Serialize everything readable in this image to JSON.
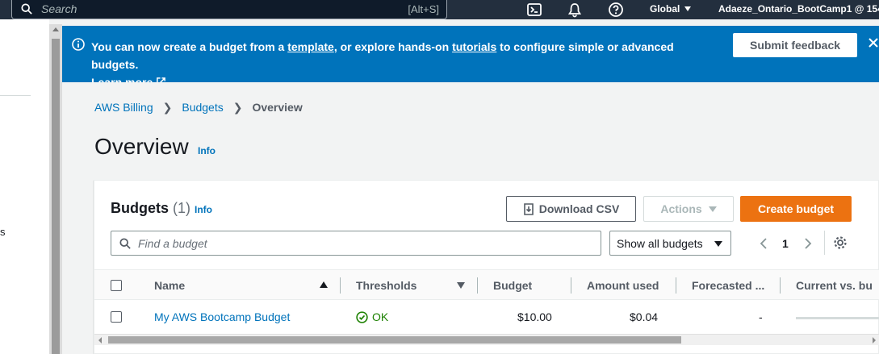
{
  "topnav": {
    "search_placeholder": "Search",
    "search_shortcut": "[Alt+S]",
    "region": "Global",
    "account": "Adaeze_Ontario_BootCamp1 @ 154"
  },
  "sidebar": {
    "fragment": "s"
  },
  "banner": {
    "text_1": "You can now create a budget from a ",
    "link_template": "template",
    "text_2": ", or explore hands-on ",
    "link_tutorials": "tutorials",
    "text_3": " to configure simple or advanced budgets.",
    "learn_more": "Learn more",
    "feedback_label": "Submit feedback"
  },
  "breadcrumb": {
    "items": [
      "AWS Billing",
      "Budgets"
    ],
    "current": "Overview"
  },
  "page": {
    "title": "Overview",
    "info": "Info"
  },
  "budgets_panel": {
    "title": "Budgets",
    "count": "(1)",
    "info": "Info",
    "download_label": "Download CSV",
    "actions_label": "Actions",
    "create_label": "Create budget",
    "find_placeholder": "Find a budget",
    "filter_value": "Show all budgets",
    "page_number": "1",
    "columns": [
      "Name",
      "Thresholds",
      "Budget",
      "Amount used",
      "Forecasted ...",
      "Current vs. bu"
    ],
    "rows": [
      {
        "name": "My AWS Bootcamp Budget",
        "threshold": "OK",
        "budget": "$10.00",
        "amount_used": "$0.04",
        "forecasted": "-"
      }
    ]
  },
  "colors": {
    "nav": "#232f3e",
    "banner": "#0073bb",
    "primary": "#ec7211",
    "link": "#0073bb",
    "ok": "#1d8102"
  }
}
